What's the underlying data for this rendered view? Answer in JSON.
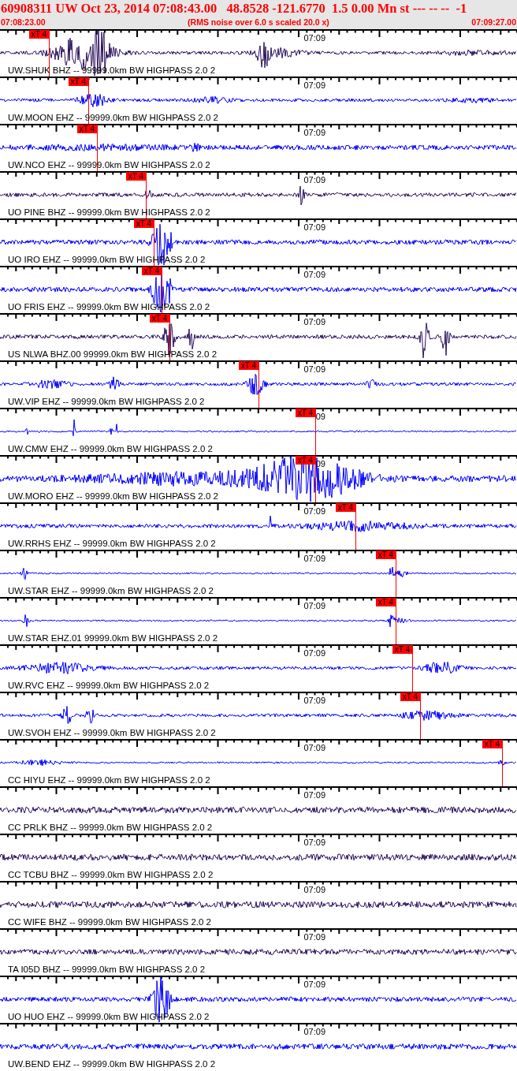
{
  "header": {
    "title": "60908311 UW Oct 23, 2014 07:08:43.00   48.8528 -121.6770  1.5 0.00 Mn st --- -- --  -1",
    "start_time": "07:08:23.00",
    "note": "(RMS noise over 6.0 s scaled 20.0 x)",
    "end_time": "07:09:27.00"
  },
  "traces": [
    {
      "label": "UW.SHUK BHZ -- 99999.0km BW HIGHPASS 2.0 2",
      "time_label": "07:09",
      "color": "#2a0f5c",
      "pick": "xT 4"
    },
    {
      "label": "UW.MOON EHZ -- 99999.0km BW HIGHPASS 2.0 2",
      "time_label": "07:09",
      "color": "#0000ff",
      "pick": "xT 4"
    },
    {
      "label": "UW.NCO EHZ -- 99999.0km BW HIGHPASS 2.0 2",
      "time_label": "07:09",
      "color": "#0000ff",
      "pick": "xT 4"
    },
    {
      "label": "UO PINE BHZ -- 99999.0km BW HIGHPASS 2.0 2",
      "time_label": "07:09",
      "color": "#2a0f5c",
      "pick": "xT 4"
    },
    {
      "label": "UO IRO EHZ -- 99999.0km BW HIGHPASS 2.0 2",
      "time_label": "07:09",
      "color": "#0000ff",
      "pick": "xT 4"
    },
    {
      "label": "UO FRIS EHZ -- 99999.0km BW HIGHPASS 2.0 2",
      "time_label": "07:09",
      "color": "#0000ff",
      "pick": "xT 4"
    },
    {
      "label": "US NLWA BHZ.00 99999.0km BW HIGHPASS 2.0 2",
      "time_label": "07:09",
      "color": "#2a0f5c",
      "pick": "xT 4"
    },
    {
      "label": "UW.VIP EHZ -- 99999.0km BW HIGHPASS 2.0 2",
      "time_label": "07:09",
      "color": "#0000ff",
      "pick": "xT 4"
    },
    {
      "label": "UW.CMW EHZ -- 99999.0km BW HIGHPASS 2.0 2",
      "time_label": "09",
      "color": "#0000ff",
      "pick": "xT 4"
    },
    {
      "label": "UW.MORO EHZ -- 99999.0km BW HIGHPASS 2.0 2",
      "time_label": "09",
      "color": "#0000ff",
      "pick": "xT 4"
    },
    {
      "label": "UW.RRHS EHZ -- 99999.0km BW HIGHPASS 2.0 2",
      "time_label": "07:09",
      "color": "#0000ff",
      "pick": "xT 4"
    },
    {
      "label": "UW.STAR EHZ -- 99999.0km BW HIGHPASS 2.0 2",
      "time_label": "07:09",
      "color": "#0000ff",
      "pick": "xT 4"
    },
    {
      "label": "UW.STAR EHZ.01 99999.0km BW HIGHPASS 2.0 2",
      "time_label": "07:09",
      "color": "#0000ff",
      "pick": "xT 4"
    },
    {
      "label": "UW.RVC EHZ -- 99999.0km BW HIGHPASS 2.0 2",
      "time_label": "07:09",
      "color": "#0000ff",
      "pick": "xT 4"
    },
    {
      "label": "UW.SVOH EHZ -- 99999.0km BW HIGHPASS 2.0 2",
      "time_label": "07:09",
      "color": "#0000ff",
      "pick": "xT 4"
    },
    {
      "label": "CC HIYU EHZ -- 99999.0km BW HIGHPASS 2.0 2",
      "time_label": "07:09",
      "color": "#0000ff",
      "pick": "xT 4"
    },
    {
      "label": "CC PRLK BHZ -- 99999.0km BW HIGHPASS 2.0 2",
      "time_label": "07:09",
      "color": "#2a0f5c"
    },
    {
      "label": "CC TCBU BHZ -- 99999.0km BW HIGHPASS 2.0 2",
      "time_label": "07:09",
      "color": "#2a0f5c"
    },
    {
      "label": "CC WIFE BHZ -- 99999.0km BW HIGHPASS 2.0 2",
      "time_label": "07:09",
      "color": "#2a0f5c"
    },
    {
      "label": "TA I05D BHZ -- 99999.0km BW HIGHPASS 2.0 2",
      "time_label": "07:09",
      "color": "#2a0f5c"
    },
    {
      "label": "UO HUO EHZ -- 99999.0km BW HIGHPASS 2.0 2",
      "time_label": "07:09",
      "color": "#0000ff"
    },
    {
      "label": "UW.BEND EHZ -- 99999.0km BW HIGHPASS 2.0 2",
      "time_label": "07:09",
      "color": "#0000ff"
    }
  ]
}
